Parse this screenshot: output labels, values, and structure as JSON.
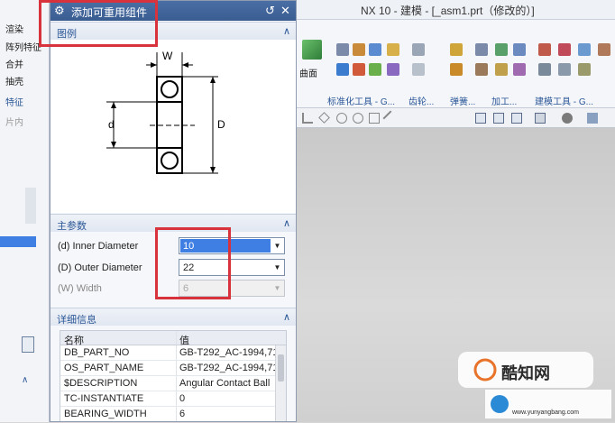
{
  "window": {
    "title": "NX 10 - 建模 - [_asm1.prt（修改的）]"
  },
  "left_pane": {
    "labels": [
      "渲染",
      "阵列特征",
      "合并",
      "抽壳",
      "特征",
      "片内"
    ]
  },
  "ribbon": {
    "groups": [
      {
        "label": "曲面"
      },
      {
        "label": "标准化工具 - G..."
      },
      {
        "label": "齿轮..."
      },
      {
        "label": "弹簧..."
      },
      {
        "label": "加工..."
      },
      {
        "label": "建模工具 - G..."
      }
    ]
  },
  "dialog": {
    "title": "添加可重用组件",
    "legend_section": {
      "label": "图例"
    },
    "figure_labels": {
      "w": "W",
      "d": "d",
      "D": "D"
    },
    "main_params_section": {
      "label": "主参数"
    },
    "params": [
      {
        "label": "(d) Inner Diameter",
        "value": "10",
        "selected": true,
        "enabled": true
      },
      {
        "label": "(D) Outer Diameter",
        "value": "22",
        "selected": false,
        "enabled": true
      },
      {
        "label": "(W) Width",
        "value": "6",
        "selected": false,
        "enabled": false
      }
    ],
    "details_section": {
      "label": "详细信息"
    },
    "details_table": {
      "headers": [
        "名称",
        "值"
      ],
      "rows": [
        [
          "DB_PART_NO",
          "GB-T292_AC-1994,71"
        ],
        [
          "OS_PART_NAME",
          "GB-T292_AC-1994,71"
        ],
        [
          "$DESCRIPTION",
          "Angular Contact Ball"
        ],
        [
          "TC-INSTANTIATE",
          "0"
        ],
        [
          "BEARING_WIDTH",
          "6"
        ]
      ]
    }
  },
  "watermark": {
    "text": "酷知网",
    "subtext": "www.yunyangbang.com"
  },
  "colors": {
    "accent": "#3f7ee2",
    "title_bar": "#3a5d91",
    "annotation": "#d8323c"
  }
}
